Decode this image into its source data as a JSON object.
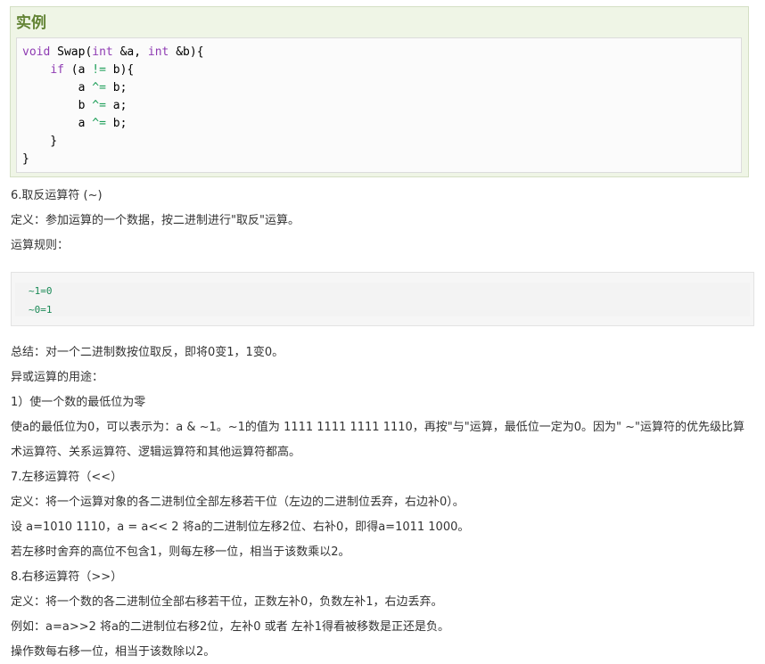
{
  "example": {
    "title": "实例",
    "code": {
      "line1": {
        "type": "void",
        "name": " Swap(",
        "type2": "int",
        "p1": " &a, ",
        "type3": "int",
        "p2": " &b){"
      },
      "line2": {
        "indent": "    ",
        "kw": "if",
        "open": " (a ",
        "op": "!=",
        "close": " b){"
      },
      "line3": {
        "indent": "        ",
        "var": "a ",
        "op": "^=",
        "rest": " b;"
      },
      "line4": {
        "indent": "        ",
        "var": "b ",
        "op": "^=",
        "rest": " a;"
      },
      "line5": {
        "indent": "        ",
        "var": "a ",
        "op": "^=",
        "rest": " b;"
      },
      "line6": "    }",
      "line7": "}"
    }
  },
  "paragraphs": {
    "p1": "6.取反运算符 (~)",
    "p2": "定义：参加运算的一个数据，按二进制进行\"取反\"运算。",
    "p3": "运算规则：",
    "p4": "总结：对一个二进制数按位取反，即将0变1，1变0。",
    "p5": "异或运算的用途：",
    "p6": "1）使一个数的最低位为零",
    "p7": "使a的最低位为0，可以表示为：a & ~1。~1的值为 1111 1111 1111 1110，再按\"与\"运算，最低位一定为0。因为\" ~\"运算符的优先级比算",
    "p8": "术运算符、关系运算符、逻辑运算符和其他运算符都高。",
    "p9": "7.左移运算符（<<）",
    "p10": "定义：将一个运算对象的各二进制位全部左移若干位（左边的二进制位丢弃，右边补0）。",
    "p11": "设 a=1010 1110，a = a<< 2 将a的二进制位左移2位、右补0，即得a=1011 1000。",
    "p12": "若左移时舍弃的高位不包含1，则每左移一位，相当于该数乘以2。",
    "p13": "8.右移运算符（>>）",
    "p14": "定义：将一个数的各二进制位全部右移若干位，正数左补0，负数左补1，右边丢弃。",
    "p15": "例如：a=a>>2 将a的二进制位右移2位，左补0 或者 左补1得看被移数是正还是负。",
    "p16": "操作数每右移一位，相当于该数除以2。"
  },
  "rules": {
    "line1": "~1=0",
    "line2": "~0=1"
  }
}
